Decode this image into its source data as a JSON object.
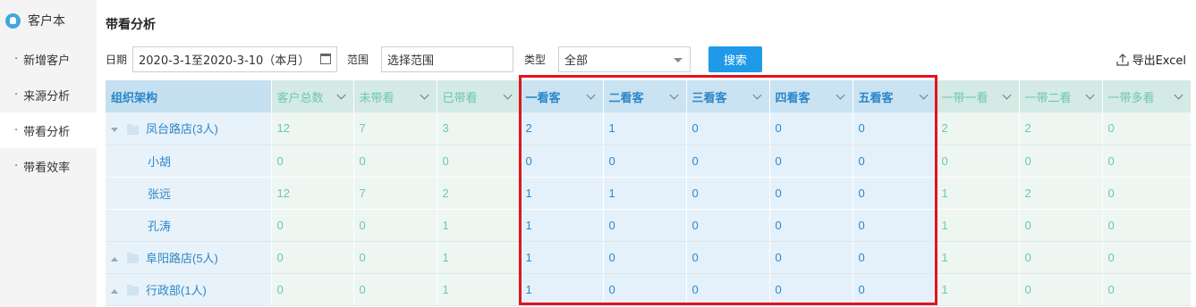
{
  "sidebar": {
    "brand": "客户本",
    "items": [
      {
        "label": "新增客户",
        "active": false
      },
      {
        "label": "来源分析",
        "active": false
      },
      {
        "label": "带看分析",
        "active": true
      },
      {
        "label": "带看效率",
        "active": false
      }
    ]
  },
  "page": {
    "title": "带看分析"
  },
  "filters": {
    "date_label": "日期",
    "date_value": "2020-3-1至2020-3-10（本月）",
    "range_label": "范围",
    "range_placeholder": "选择范围",
    "type_label": "类型",
    "type_value": "全部",
    "search_button": "搜索",
    "export_label": "导出Excel"
  },
  "table": {
    "columns": [
      "组织架构",
      "客户总数",
      "未带看",
      "已带看",
      "一看客",
      "二看客",
      "三看客",
      "四看客",
      "五看客",
      "一带一看",
      "一带二看",
      "一带多看"
    ],
    "rows": [
      {
        "name": "凤台路店(3人)",
        "type": "group",
        "expanded": true,
        "values": [
          "12",
          "7",
          "3",
          "2",
          "1",
          "0",
          "0",
          "0",
          "2",
          "2",
          "0"
        ]
      },
      {
        "name": "小胡",
        "type": "member",
        "values": [
          "0",
          "0",
          "0",
          "0",
          "0",
          "0",
          "0",
          "0",
          "0",
          "0",
          "0"
        ]
      },
      {
        "name": "张远",
        "type": "member",
        "values": [
          "12",
          "7",
          "2",
          "1",
          "1",
          "0",
          "0",
          "0",
          "1",
          "2",
          "0"
        ]
      },
      {
        "name": "孔涛",
        "type": "member",
        "values": [
          "0",
          "0",
          "1",
          "1",
          "0",
          "0",
          "0",
          "0",
          "1",
          "0",
          "0"
        ]
      },
      {
        "name": "阜阳路店(5人)",
        "type": "group",
        "expanded": false,
        "values": [
          "0",
          "0",
          "1",
          "1",
          "0",
          "0",
          "0",
          "0",
          "1",
          "0",
          "0"
        ]
      },
      {
        "name": "行政部(1人)",
        "type": "group",
        "expanded": false,
        "values": [
          "0",
          "0",
          "1",
          "1",
          "0",
          "0",
          "0",
          "0",
          "1",
          "0",
          "0"
        ]
      }
    ]
  },
  "colors": {
    "accent": "#1e9ae8",
    "highlight_border": "#e2141d",
    "teal_text": "#6cc7ae",
    "blue_text": "#2c86c8"
  }
}
